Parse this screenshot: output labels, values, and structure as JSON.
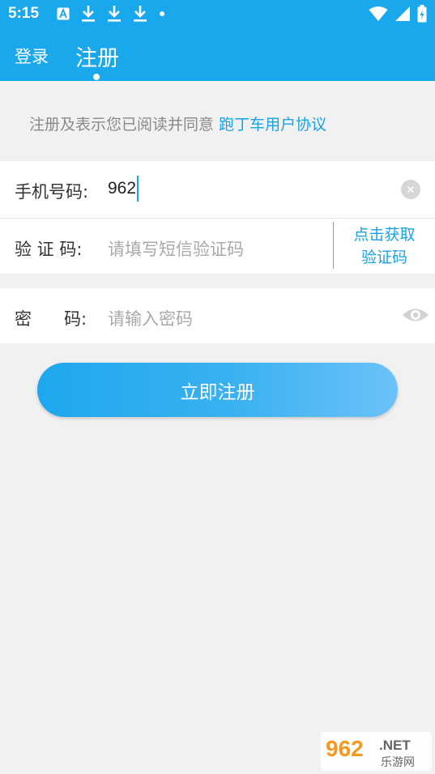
{
  "status_bar": {
    "time": "5:15",
    "icons": [
      "a-icon",
      "download-icon",
      "download-icon",
      "download-icon",
      "dot-icon",
      "wifi-icon",
      "signal-icon",
      "battery-icon"
    ]
  },
  "header": {
    "tab_login": "登录",
    "tab_register": "注册"
  },
  "agreement": {
    "text": "注册及表示您已阅读并同意",
    "link": "跑丁车用户协议"
  },
  "form": {
    "phone_label": "手机号码:",
    "phone_value": "962",
    "code_label": "验 证 码:",
    "code_placeholder": "请填写短信验证码",
    "get_code_line1": "点击获取",
    "get_code_line2": "验证码",
    "password_label": "密      码:",
    "password_placeholder": "请输入密码"
  },
  "register_button": "立即注册",
  "watermark": {
    "brand": "962",
    "suffix": ".NET",
    "sub": "乐游网"
  },
  "colors": {
    "primary": "#1aa8ec",
    "link": "#1aa3e6",
    "background": "#f1f1f1"
  }
}
